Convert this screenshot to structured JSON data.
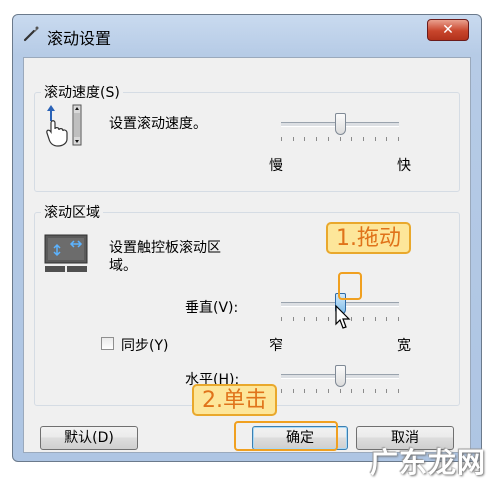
{
  "window": {
    "title": "滚动设置",
    "close_symbol": "✕"
  },
  "speed_group": {
    "title": "滚动速度(S)",
    "description": "设置滚动速度。",
    "min_label": "慢",
    "max_label": "快",
    "slider_level": 0.5
  },
  "area_group": {
    "title": "滚动区域",
    "description_line1": "设置触控板滚动区",
    "description_line2": "域。",
    "vertical_label": "垂直(V):",
    "vertical_level": 0.5,
    "sync_label": "同步(Y)",
    "sync_checked": false,
    "narrow_label": "窄",
    "wide_label": "宽",
    "horizontal_label": "水平(H):",
    "horizontal_level": 0.5
  },
  "buttons": {
    "default_label": "默认(D)",
    "ok_label": "确定",
    "cancel_label": "取消"
  },
  "annotations": {
    "step1": "1.拖动",
    "step2": "2.单击"
  },
  "watermark": "广东龙网",
  "colors": {
    "callout_fill": "#fde69a",
    "callout_text": "#e0731a",
    "callout_border": "#e9a82c"
  }
}
